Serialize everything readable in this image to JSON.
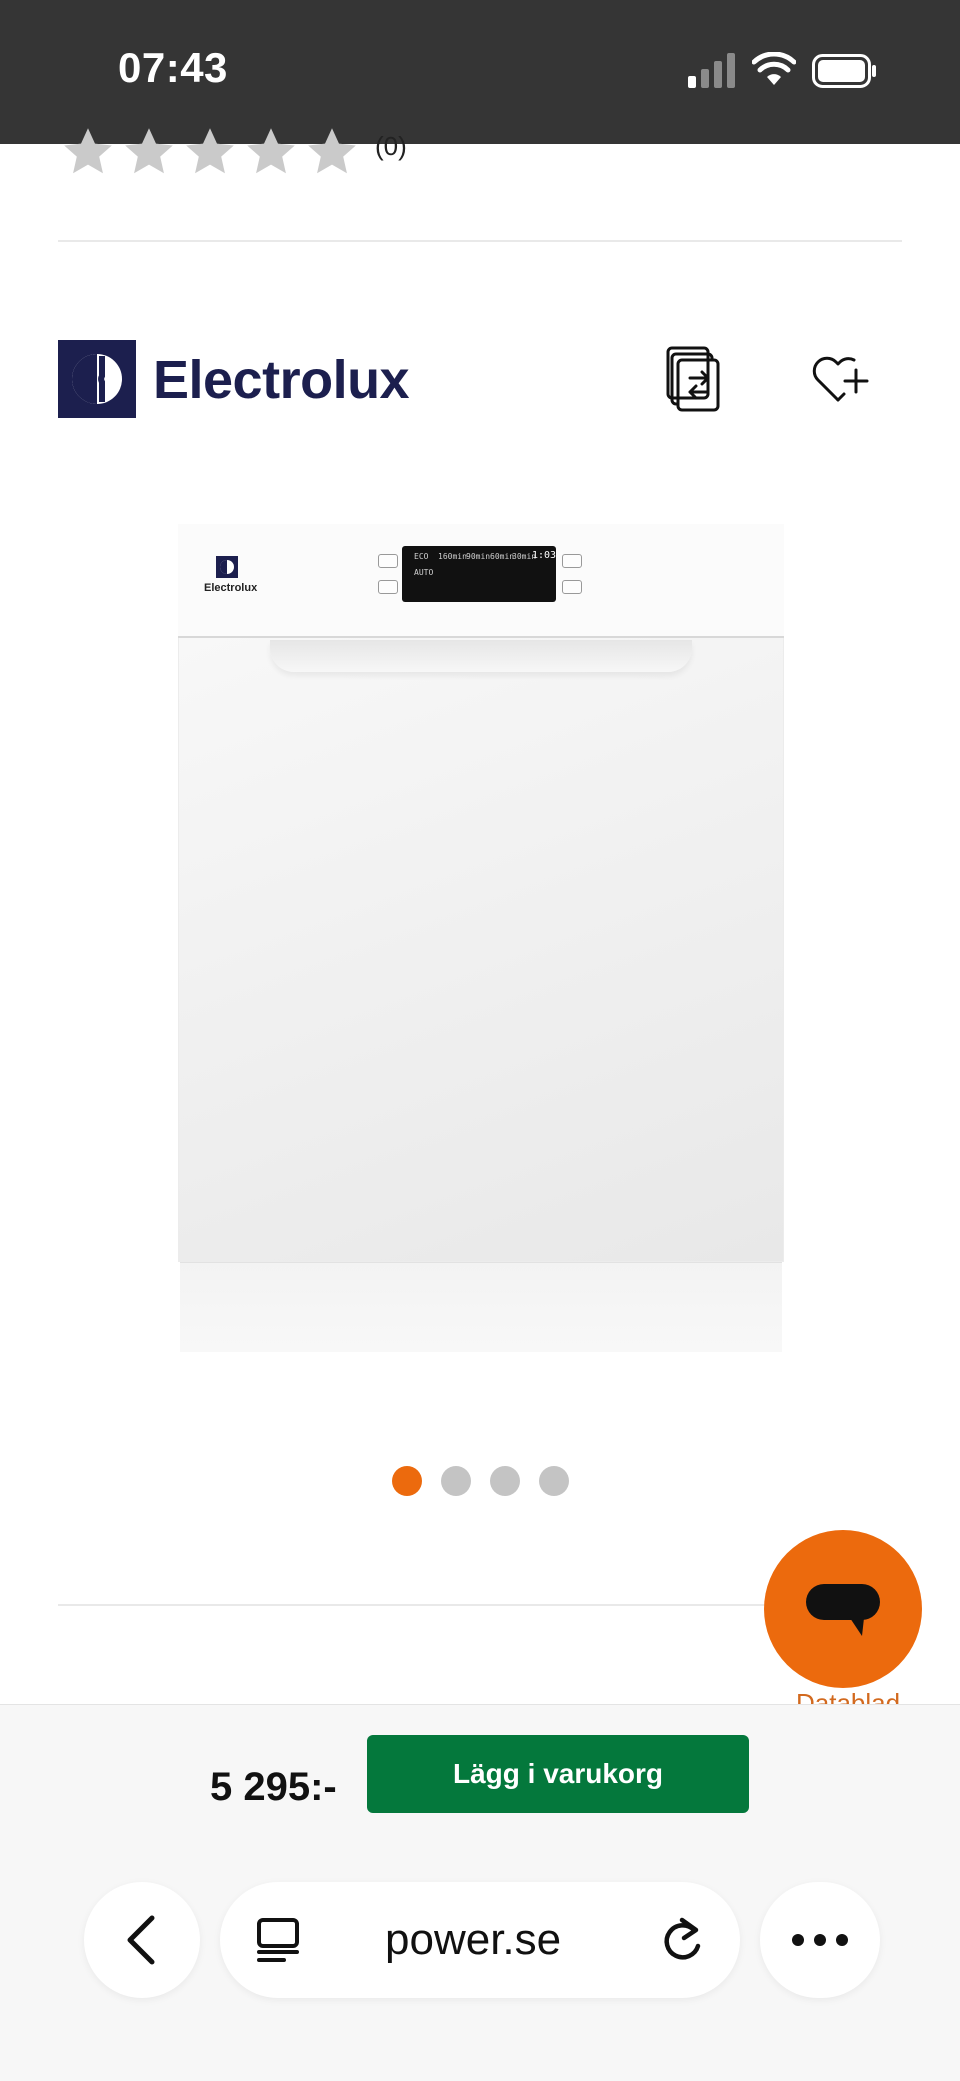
{
  "status_bar": {
    "time": "07:43",
    "icons": [
      "cellular-signal-icon",
      "wifi-icon",
      "battery-icon"
    ]
  },
  "rating": {
    "stars_filled": 0,
    "stars_total": 5,
    "count": "(0)"
  },
  "brand": {
    "name": "Electrolux",
    "logo": "electrolux-logo"
  },
  "actions": {
    "compare_icon": "compare-icon",
    "favorite_icon": "heart-plus-icon"
  },
  "product_image": {
    "alt": "Electrolux dishwasher",
    "panel_brand": "Electrolux",
    "display_labels": [
      "ECO",
      "160min",
      "90min",
      "60min",
      "30min",
      "1:03",
      "AUTO"
    ]
  },
  "carousel": {
    "count": 4,
    "active_index": 0
  },
  "chat": {
    "icon": "chat-bubble-icon"
  },
  "datablad_link": "Datablad",
  "purchase": {
    "price": "5 295:-",
    "add_to_cart": "Lägg i varukorg"
  },
  "browser": {
    "url": "power.se",
    "back_icon": "chevron-left-icon",
    "reader_icon": "reader-icon",
    "reload_icon": "reload-icon",
    "more_icon": "more-icon"
  },
  "colors": {
    "accent_orange": "#ec6a0d",
    "cart_green": "#04783c",
    "brand_navy": "#1c1f4e",
    "status_bar": "#353535"
  }
}
